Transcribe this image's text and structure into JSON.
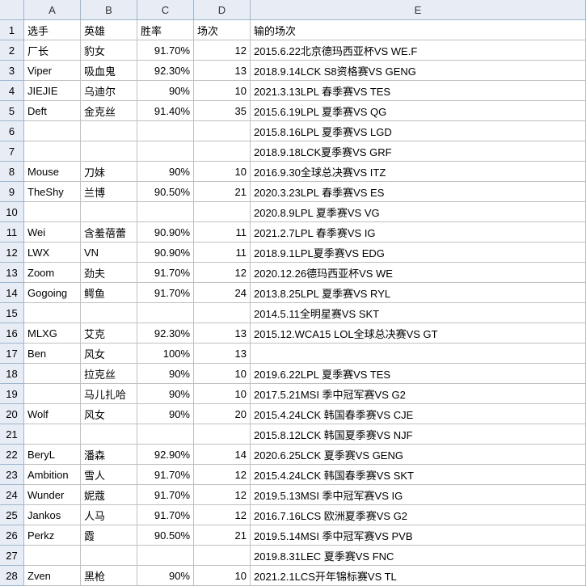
{
  "columns": [
    "A",
    "B",
    "C",
    "D",
    "E"
  ],
  "headers": {
    "A": "选手",
    "B": "英雄",
    "C": "胜率",
    "D": "场次",
    "E": "输的场次"
  },
  "rows": [
    {
      "n": 1,
      "A": "选手",
      "B": "英雄",
      "C": "胜率",
      "D": "场次",
      "E": "输的场次",
      "isHeader": true
    },
    {
      "n": 2,
      "A": "厂长",
      "B": "豹女",
      "C": "91.70%",
      "D": "12",
      "E": "2015.6.22北京德玛西亚杯VS WE.F"
    },
    {
      "n": 3,
      "A": "Viper",
      "B": "吸血鬼",
      "C": "92.30%",
      "D": "13",
      "E": "2018.9.14LCK S8资格赛VS GENG"
    },
    {
      "n": 4,
      "A": "JIEJIE",
      "B": "乌迪尔",
      "C": "90%",
      "D": "10",
      "E": "2021.3.13LPL 春季赛VS TES"
    },
    {
      "n": 5,
      "A": "Deft",
      "B": "金克丝",
      "C": "91.40%",
      "D": "35",
      "E": "2015.6.19LPL 夏季赛VS QG"
    },
    {
      "n": 6,
      "A": "",
      "B": "",
      "C": "",
      "D": "",
      "E": "2015.8.16LPL 夏季赛VS LGD"
    },
    {
      "n": 7,
      "A": "",
      "B": "",
      "C": "",
      "D": "",
      "E": "2018.9.18LCK夏季赛VS GRF"
    },
    {
      "n": 8,
      "A": "Mouse",
      "B": "刀妹",
      "C": "90%",
      "D": "10",
      "E": "2016.9.30全球总决赛VS ITZ"
    },
    {
      "n": 9,
      "A": "TheShy",
      "B": "兰博",
      "C": "90.50%",
      "D": "21",
      "E": "2020.3.23LPL 春季赛VS ES"
    },
    {
      "n": 10,
      "A": "",
      "B": "",
      "C": "",
      "D": "",
      "E": "2020.8.9LPL 夏季赛VS VG"
    },
    {
      "n": 11,
      "A": "Wei",
      "B": "含羞蓓蕾",
      "C": "90.90%",
      "D": "11",
      "E": "2021.2.7LPL 春季赛VS IG"
    },
    {
      "n": 12,
      "A": "LWX",
      "B": "VN",
      "C": "90.90%",
      "D": "11",
      "E": "2018.9.1LPL夏季赛VS EDG"
    },
    {
      "n": 13,
      "A": "Zoom",
      "B": "劲夫",
      "C": "91.70%",
      "D": "12",
      "E": "2020.12.26德玛西亚杯VS WE"
    },
    {
      "n": 14,
      "A": "Gogoing",
      "B": "鳄鱼",
      "C": "91.70%",
      "D": "24",
      "E": "2013.8.25LPL 夏季赛VS RYL"
    },
    {
      "n": 15,
      "A": "",
      "B": "",
      "C": "",
      "D": "",
      "E": "2014.5.11全明星赛VS SKT"
    },
    {
      "n": 16,
      "A": "MLXG",
      "B": "艾克",
      "C": "92.30%",
      "D": "13",
      "E": "2015.12.WCA15 LOL全球总决赛VS GT"
    },
    {
      "n": 17,
      "A": "Ben",
      "B": "风女",
      "C": "100%",
      "D": "13",
      "E": ""
    },
    {
      "n": 18,
      "A": "",
      "B": "拉克丝",
      "C": "90%",
      "D": "10",
      "E": "2019.6.22LPL 夏季赛VS TES"
    },
    {
      "n": 19,
      "A": "",
      "B": "马儿扎哈",
      "C": "90%",
      "D": "10",
      "E": "2017.5.21MSI 季中冠军赛VS G2"
    },
    {
      "n": 20,
      "A": "Wolf",
      "B": "风女",
      "C": "90%",
      "D": "20",
      "E": "2015.4.24LCK 韩国春季赛VS CJE"
    },
    {
      "n": 21,
      "A": "",
      "B": "",
      "C": "",
      "D": "",
      "E": "2015.8.12LCK 韩国夏季赛VS NJF"
    },
    {
      "n": 22,
      "A": "BeryL",
      "B": "潘森",
      "C": "92.90%",
      "D": "14",
      "E": "2020.6.25LCK 夏季赛VS GENG"
    },
    {
      "n": 23,
      "A": "Ambition",
      "B": "雪人",
      "C": "91.70%",
      "D": "12",
      "E": "2015.4.24LCK 韩国春季赛VS SKT"
    },
    {
      "n": 24,
      "A": "Wunder",
      "B": "妮蔻",
      "C": "91.70%",
      "D": "12",
      "E": "2019.5.13MSI 季中冠军赛VS IG"
    },
    {
      "n": 25,
      "A": "Jankos",
      "B": "人马",
      "C": "91.70%",
      "D": "12",
      "E": "2016.7.16LCS 欧洲夏季赛VS G2"
    },
    {
      "n": 26,
      "A": "Perkz",
      "B": "霞",
      "C": "90.50%",
      "D": "21",
      "E": "2019.5.14MSI 季中冠军赛VS PVB"
    },
    {
      "n": 27,
      "A": "",
      "B": "",
      "C": "",
      "D": "",
      "E": "2019.8.31LEC 夏季赛VS FNC"
    },
    {
      "n": 28,
      "A": "Zven",
      "B": "黑枪",
      "C": "90%",
      "D": "10",
      "E": "2021.2.1LCS开年锦标赛VS TL"
    }
  ]
}
